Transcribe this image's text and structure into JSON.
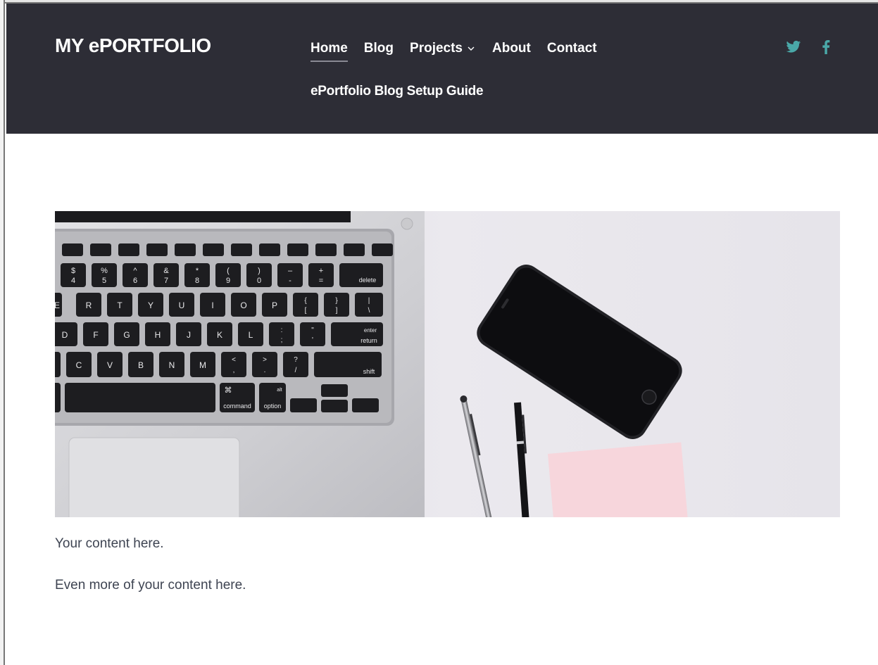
{
  "site": {
    "logo": "MY ePORTFOLIO"
  },
  "nav": {
    "items": [
      {
        "label": "Home",
        "active": true
      },
      {
        "label": "Blog",
        "active": false
      },
      {
        "label": "Projects",
        "active": false,
        "has_dropdown": true
      },
      {
        "label": "About",
        "active": false
      },
      {
        "label": "Contact",
        "active": false
      }
    ],
    "secondary": "ePortfolio Blog Setup Guide"
  },
  "social": {
    "icons": [
      "twitter-icon",
      "facebook-icon"
    ],
    "color": "#4aa8a8"
  },
  "hero": {
    "keys_row1": [
      "$",
      "4",
      "%",
      "5",
      "^",
      "6",
      "&",
      "7",
      "*",
      "8",
      "(",
      "9",
      ")",
      "0",
      "–",
      "-",
      "+",
      "=",
      "delete"
    ],
    "keys_row2": [
      "E",
      "R",
      "T",
      "Y",
      "U",
      "I",
      "O",
      "P",
      "{",
      "[",
      "}",
      "]",
      "|",
      "\\"
    ],
    "keys_row3": [
      "D",
      "F",
      "G",
      "H",
      "J",
      "K",
      "L",
      ":",
      ";",
      "\"",
      "'",
      "enter",
      "return"
    ],
    "keys_row4": [
      "C",
      "V",
      "B",
      "N",
      "M",
      "<",
      ",",
      ">",
      ".",
      "?",
      "/",
      "shift"
    ],
    "keys_row5": [
      "⌘",
      "command",
      "alt",
      "option"
    ]
  },
  "content": {
    "paragraphs": [
      "Your content here.",
      "Even more of your content here."
    ]
  },
  "colors": {
    "header_bg": "#2d2d36",
    "text": "#3e4452",
    "accent": "#4aa8a8"
  }
}
